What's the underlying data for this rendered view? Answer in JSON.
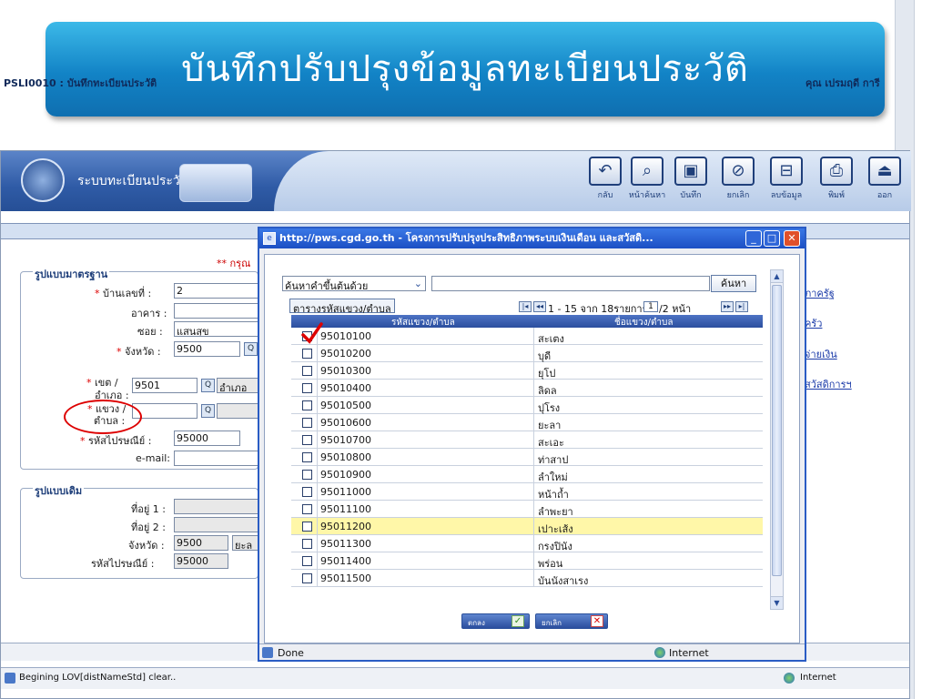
{
  "slide": {
    "title": "บันทึกปรับปรุงข้อมูลทะเบียนประวัติ"
  },
  "app": {
    "name": "ระบบทะเบียนประวัติ",
    "screen_code": "PSLI0010 : บันทึกทะเบียนประวัติ",
    "user_name": "คุณ เปรมฤดี การี",
    "required_note": "** กรุณ",
    "toolbar": [
      {
        "label": "กลับ",
        "icon": "back-arrow-icon"
      },
      {
        "label": "หน้าค้นหา",
        "icon": "search-page-icon"
      },
      {
        "label": "บันทึก",
        "icon": "save-icon"
      },
      {
        "label": "ยกเลิก",
        "icon": "cancel-icon"
      },
      {
        "label": "ลบข้อมูล",
        "icon": "delete-icon"
      },
      {
        "label": "พิมพ์",
        "icon": "print-icon"
      },
      {
        "label": "ออก",
        "icon": "exit-icon"
      }
    ]
  },
  "form": {
    "standard_section": "รูปแบบมาตรฐาน",
    "house_no_label": "บ้านเลขที่ :",
    "house_no_value": "2",
    "building_label": "อาคาร :",
    "building_value": "",
    "soi_label": "ซอย :",
    "soi_value": "แสนสุข",
    "province_label": "จังหวัด :",
    "province_value": "9500",
    "district_label_1": "เขต /",
    "district_label_2": "อำเภอ :",
    "district_value": "9501",
    "district_name": "อำเภอ",
    "subdistrict_label_1": "แขวง /",
    "subdistrict_label_2": "ตำบล :",
    "subdistrict_value": "",
    "postcode_label": "รหัสไปรษณีย์ :",
    "postcode_value": "95000",
    "email_label": "e-mail:",
    "email_value": "",
    "old_section": "รูปแบบเดิม",
    "addr1_label": "ที่อยู่ 1 :",
    "addr2_label": "ที่อยู่ 2 :",
    "old_province_label": "จังหวัด :",
    "old_province_value": "9500",
    "old_province_name": "ยะล",
    "old_postcode_label": "รหัสไปรษณีย์ :",
    "old_postcode_value": "95000",
    "required_mark": "*"
  },
  "right_links": [
    "ภาครัฐ",
    "ครัว",
    "จ่ายเงิน",
    "สวัสดิการฯ"
  ],
  "popup": {
    "title": "http://pws.cgd.go.th - โครงการปรับปรุงประสิทธิภาพระบบเงินเดือน และสวัสดิ...",
    "search_mode": "ค้นหาคำขึ้นต้นด้วย",
    "search_value": "",
    "search_button": "ค้นหา",
    "table_caption": "ตารางรหัสแขวง/ตำบล",
    "pager_text_1": "1 - 15 จาก 18รายการ",
    "pager_page": "1",
    "pager_text_2": "/2 หน้า",
    "col_code": "รหัสแขวง/ตำบล",
    "col_name": "ชื่อแขวง/ตำบล",
    "ok_button": "ตกลง",
    "cancel_button": "ยกเลิก",
    "status_done": "Done",
    "status_zone": "Internet",
    "rows": [
      {
        "code": "95010100",
        "name": "สะเตง"
      },
      {
        "code": "95010200",
        "name": "บุดี"
      },
      {
        "code": "95010300",
        "name": "ยุโป"
      },
      {
        "code": "95010400",
        "name": "ลิดล"
      },
      {
        "code": "95010500",
        "name": "ปุโรง"
      },
      {
        "code": "95010600",
        "name": "ยะลา"
      },
      {
        "code": "95010700",
        "name": "สะเอะ"
      },
      {
        "code": "95010800",
        "name": "ท่าสาป"
      },
      {
        "code": "95010900",
        "name": "ลำใหม่"
      },
      {
        "code": "95011000",
        "name": "หน้าถ้ำ"
      },
      {
        "code": "95011100",
        "name": "ลำพะยา"
      },
      {
        "code": "95011200",
        "name": "เปาะเส้ง"
      },
      {
        "code": "95011300",
        "name": "กรงปินัง"
      },
      {
        "code": "95011400",
        "name": "พร่อน"
      },
      {
        "code": "95011500",
        "name": "บันนังสาเรง"
      }
    ],
    "highlight_row": 11,
    "checked_row": 0
  },
  "browser_status": {
    "message": "Begining LOV[distNameStd] clear..",
    "zone": "Internet"
  },
  "colors": {
    "title_banner": "#1283c6",
    "header_blue": "#2f5ba6",
    "highlight_row": "#fff7a8",
    "annotation_red": "#d00000"
  }
}
